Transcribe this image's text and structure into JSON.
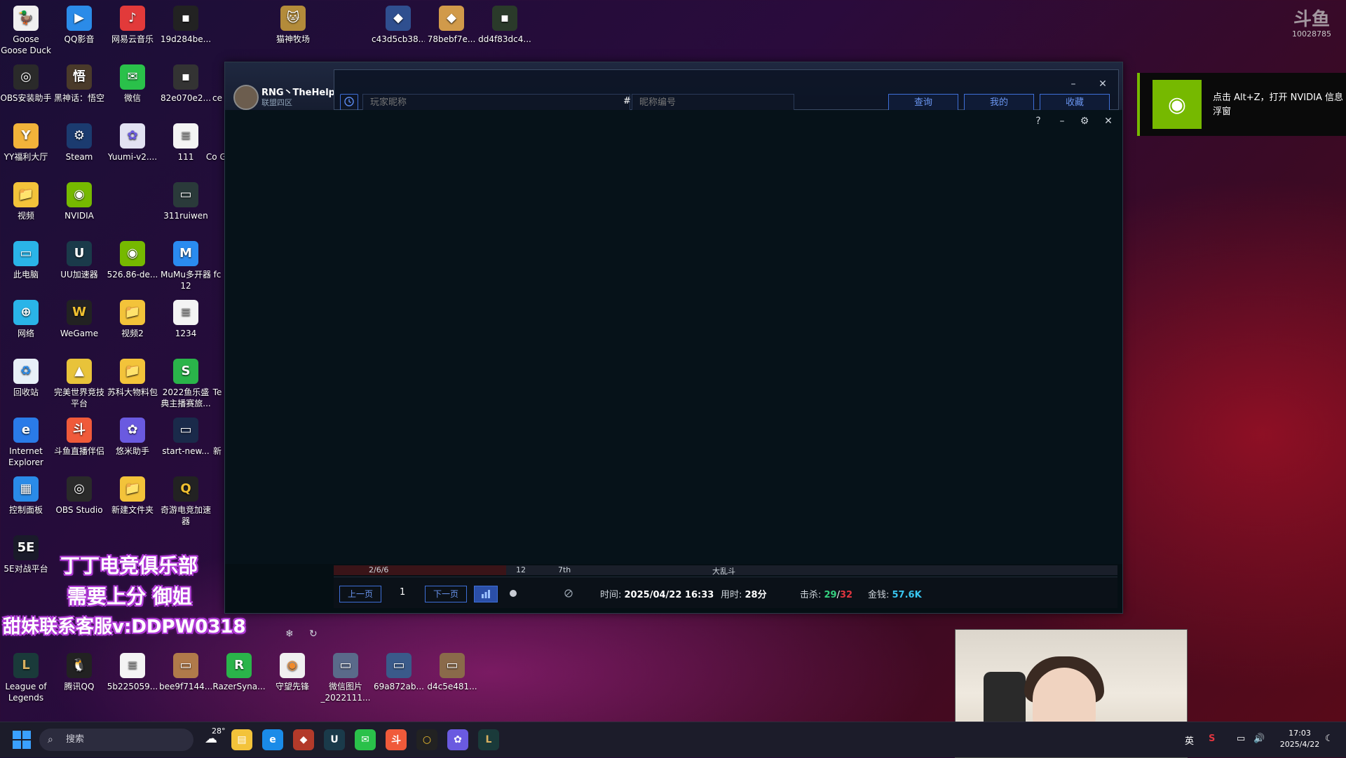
{
  "desktop": {
    "icons": [
      {
        "label": "Goose Goose Duck",
        "color": "#f4f4f4"
      },
      {
        "label": "QQ影音",
        "color": "#2b8be8"
      },
      {
        "label": "网易云音乐",
        "color": "#e23a3a"
      },
      {
        "label": "19d284be...",
        "color": "#333"
      },
      {
        "label": "猫神牧场",
        "color": "#b38b3a"
      },
      {
        "label": "c43d5cb38...",
        "color": "#2f4f8f"
      },
      {
        "label": "78bebf7e...",
        "color": "#d19a4a"
      },
      {
        "label": "dd4f83dc4...",
        "color": "#2a3a2a"
      },
      {
        "label": "OBS安装助手",
        "color": "#2a2a2a"
      },
      {
        "label": "黑神话：悟空",
        "color": "#4a3a2a"
      },
      {
        "label": "微信",
        "color": "#2ac14a"
      },
      {
        "label": "82e070e2...",
        "color": "#333"
      },
      {
        "label": "ce",
        "color": "#555"
      },
      {
        "label": "YY福利大厅",
        "color": "#f2b33a"
      },
      {
        "label": "Steam",
        "color": "#1b3b6f"
      },
      {
        "label": "Yuumi-v2....",
        "color": "#e2e2f2"
      },
      {
        "label": "111",
        "color": "#f4f4f4"
      },
      {
        "label": "Co Gl",
        "color": "#555"
      },
      {
        "label": "视频",
        "color": "#f3c33a"
      },
      {
        "label": "NVIDIA",
        "color": "#76b900"
      },
      {
        "label": "311ruiwen",
        "color": "#2a3a3a"
      },
      {
        "label": "此电脑",
        "color": "#2ab4e8"
      },
      {
        "label": "UU加速器",
        "color": "#1a3a4a"
      },
      {
        "label": "526.86-de...",
        "color": "#76b900"
      },
      {
        "label": "MuMu多开器12",
        "color": "#2a8bf0"
      },
      {
        "label": "fc",
        "color": "#555"
      },
      {
        "label": "网络",
        "color": "#2ab4e8"
      },
      {
        "label": "WeGame",
        "color": "#222"
      },
      {
        "label": "视频2",
        "color": "#f3c33a"
      },
      {
        "label": "1234",
        "color": "#f4f4f4"
      },
      {
        "label": "回收站",
        "color": "#e8f0f8"
      },
      {
        "label": "完美世界竞技平台",
        "color": "#e8c33a"
      },
      {
        "label": "苏科大物料包",
        "color": "#f3c33a"
      },
      {
        "label": "2022鱼乐盛典主播赛旅...",
        "color": "#2ab44a"
      },
      {
        "label": "Te",
        "color": "#555"
      },
      {
        "label": "Internet Explorer",
        "color": "#2a7be8"
      },
      {
        "label": "斗鱼直播伴侣",
        "color": "#f05a3a"
      },
      {
        "label": "悠米助手",
        "color": "#6a5ae0"
      },
      {
        "label": "start-new...",
        "color": "#1a2a4a"
      },
      {
        "label": "新",
        "color": "#555"
      },
      {
        "label": "控制面板",
        "color": "#2a8be8"
      },
      {
        "label": "OBS Studio",
        "color": "#2a2a2a"
      },
      {
        "label": "新建文件夹",
        "color": "#f3c33a"
      },
      {
        "label": "奇游电竞加速器",
        "color": "#222"
      },
      {
        "label": "5E对战平台",
        "color": "#1a1a2a"
      },
      {
        "label": "League of Legends",
        "color": "#1a3a3a"
      },
      {
        "label": "腾讯QQ",
        "color": "#222"
      },
      {
        "label": "5b225059...",
        "color": "#f4f4f4"
      },
      {
        "label": "bee9f7144...",
        "color": "#b07a4a"
      },
      {
        "label": "RazerSyna...",
        "color": "#2ab44a"
      },
      {
        "label": "守望先锋",
        "color": "#f0f0f0"
      },
      {
        "label": "微信图片_2022111...",
        "color": "#5a6a8a"
      },
      {
        "label": "69a872ab...",
        "color": "#3a5a8a"
      },
      {
        "label": "d4c5e481...",
        "color": "#8a6a4a"
      }
    ]
  },
  "app": {
    "logo_name": "RNG丶TheHelp",
    "logo_region": "联盟四区",
    "min_label": "–",
    "close_label": "✕",
    "player_placeholder": "玩家昵称",
    "hash": "#",
    "tag_placeholder": "昵称编号",
    "btn_query": "查询",
    "btn_mine": "我的",
    "btn_favorites": "收藏",
    "overlay_help": "?",
    "overlay_min": "–",
    "overlay_settings": "⚙",
    "overlay_close": "✕",
    "partial_row": {
      "score": "2/6/6",
      "level": "12",
      "rank": "7th",
      "mode": "大乱斗"
    },
    "pager": {
      "prev": "上一页",
      "page": "1",
      "next": "下一页",
      "time_label": "时间: ",
      "time_value": "2025/04/22 16:33",
      "duration_label": "用时: ",
      "duration_value": "28分",
      "kills_label": "击杀: ",
      "kills_value": "29",
      "kills_sep": "/",
      "kills_total": "32",
      "gold_label": "金钱: ",
      "gold_value": "57.6K"
    }
  },
  "nvidia": {
    "text": "点击 Alt+Z，打开 NVIDIA 信息浮窗"
  },
  "douyu": {
    "logo": "斗鱼",
    "room": "10028785"
  },
  "promo": {
    "line1": "丁丁电竞俱乐部",
    "line2": "需要上分 御姐",
    "line3": "甜妹联系客服v:DDPW0318"
  },
  "taskbar": {
    "search_placeholder": "搜索",
    "weather": "28°",
    "ime": "英",
    "time": "17:03",
    "date": "2025/4/22"
  },
  "colors": {
    "accent_blue": "#3e6fd8",
    "nvidia_green": "#76b900",
    "kills_green": "#35d07f",
    "kills_red": "#e0353f",
    "gold_cyan": "#39c6f0"
  }
}
